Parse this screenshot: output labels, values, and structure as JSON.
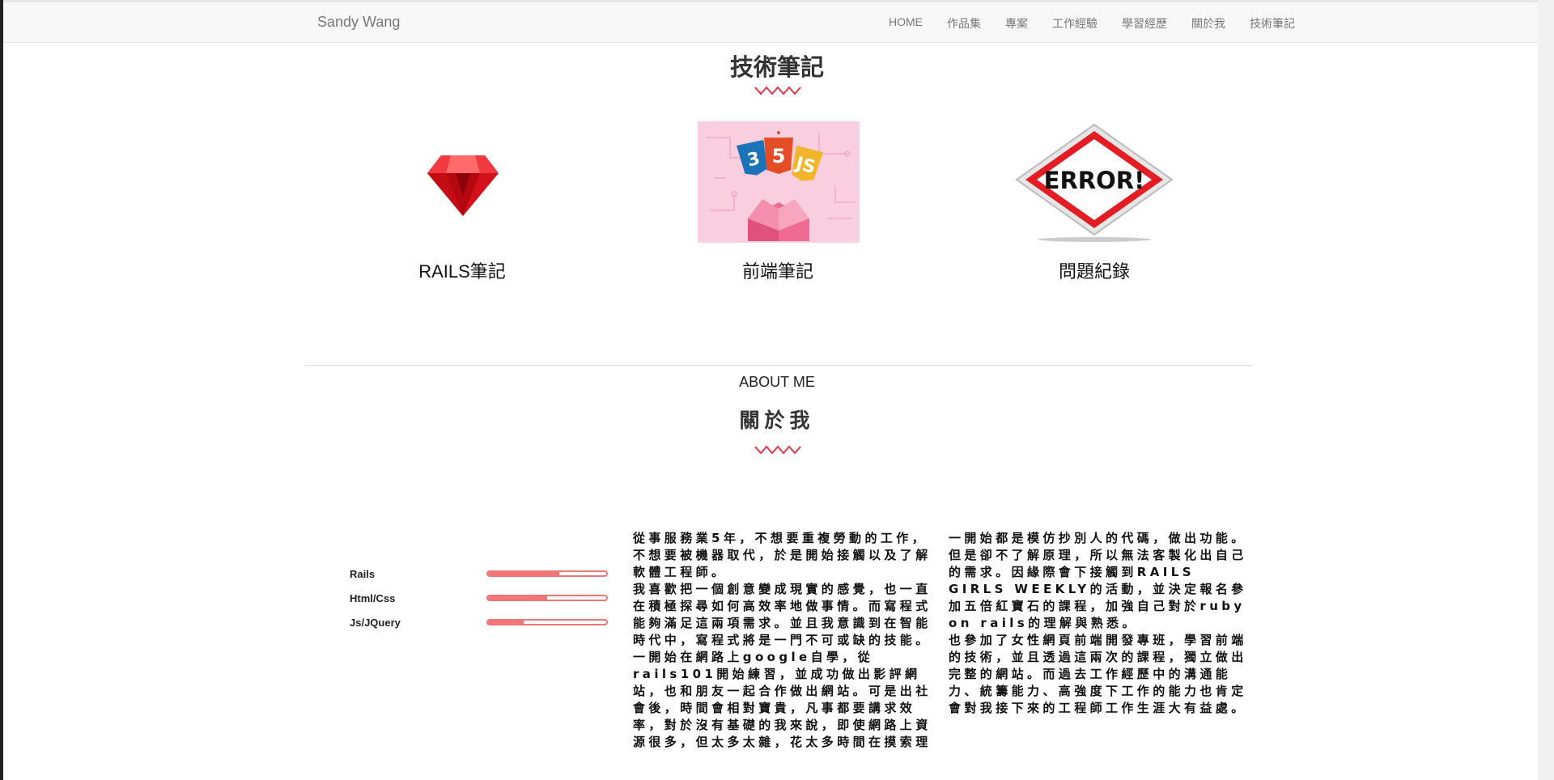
{
  "navbar": {
    "brand": "Sandy Wang",
    "links": [
      "HOME",
      "作品集",
      "專案",
      "工作經驗",
      "學習經歷",
      "關於我",
      "技術筆記"
    ]
  },
  "notes_section": {
    "title": "技術筆記",
    "cards": [
      {
        "label": "RAILS筆記",
        "icon": "ruby-gem-icon"
      },
      {
        "label": "前端筆記",
        "icon": "html5-css3-js-icon"
      },
      {
        "label": "問題紀錄",
        "icon": "error-sign-icon",
        "image_text": "ERROR!"
      }
    ]
  },
  "about_section": {
    "subtitle": "ABOUT ME",
    "title": "關於我",
    "skills": [
      {
        "name": "Rails",
        "level": 0.6
      },
      {
        "name": "Html/Css",
        "level": 0.5
      },
      {
        "name": "Js/JQuery",
        "level": 0.3
      }
    ],
    "col1": [
      "從事服務業5年，不想要重複勞動的工作，不想要被機器取代，於是開始接觸以及了解軟體工程師。",
      "我喜歡把一個創意變成現實的感覺，也一直在積極探尋如何高效率地做事情。而寫程式能夠滿足這兩項需求。並且我意識到在智能時代中，寫程式將是一門不可或缺的技能。",
      "一開始在網路上google自學，從rails101開始練習，並成功做出影評網站，也和朋友一起合作做出網站。可是出社會後，時間會相對寶貴，凡事都要講求效率，對於沒有基礎的我來說，即使網路上資源很多，但太多太雜，花太多時間在摸索理"
    ],
    "col2": [
      "一開始都是模仿抄別人的代碼，做出功能。但是卻不了解原理，所以無法客製化出自己的需求。因緣際會下接觸到RAILS GIRLS WEEKLY的活動，並決定報名參加五倍紅寶石的課程，加強自己對於ruby on rails的理解與熟悉。",
      "也參加了女性網頁前端開發專班，學習前端的技術，並且透過這兩次的課程，獨立做出完整的網站。而過去工作經歷中的溝通能力、統籌能力、高強度下工作的能力也肯定會對我接下來的工程師工作生涯大有益處。"
    ]
  },
  "colors": {
    "accent": "#f07575",
    "zigzag": "#e8334a",
    "navbar_bg": "#f8f8f8"
  }
}
